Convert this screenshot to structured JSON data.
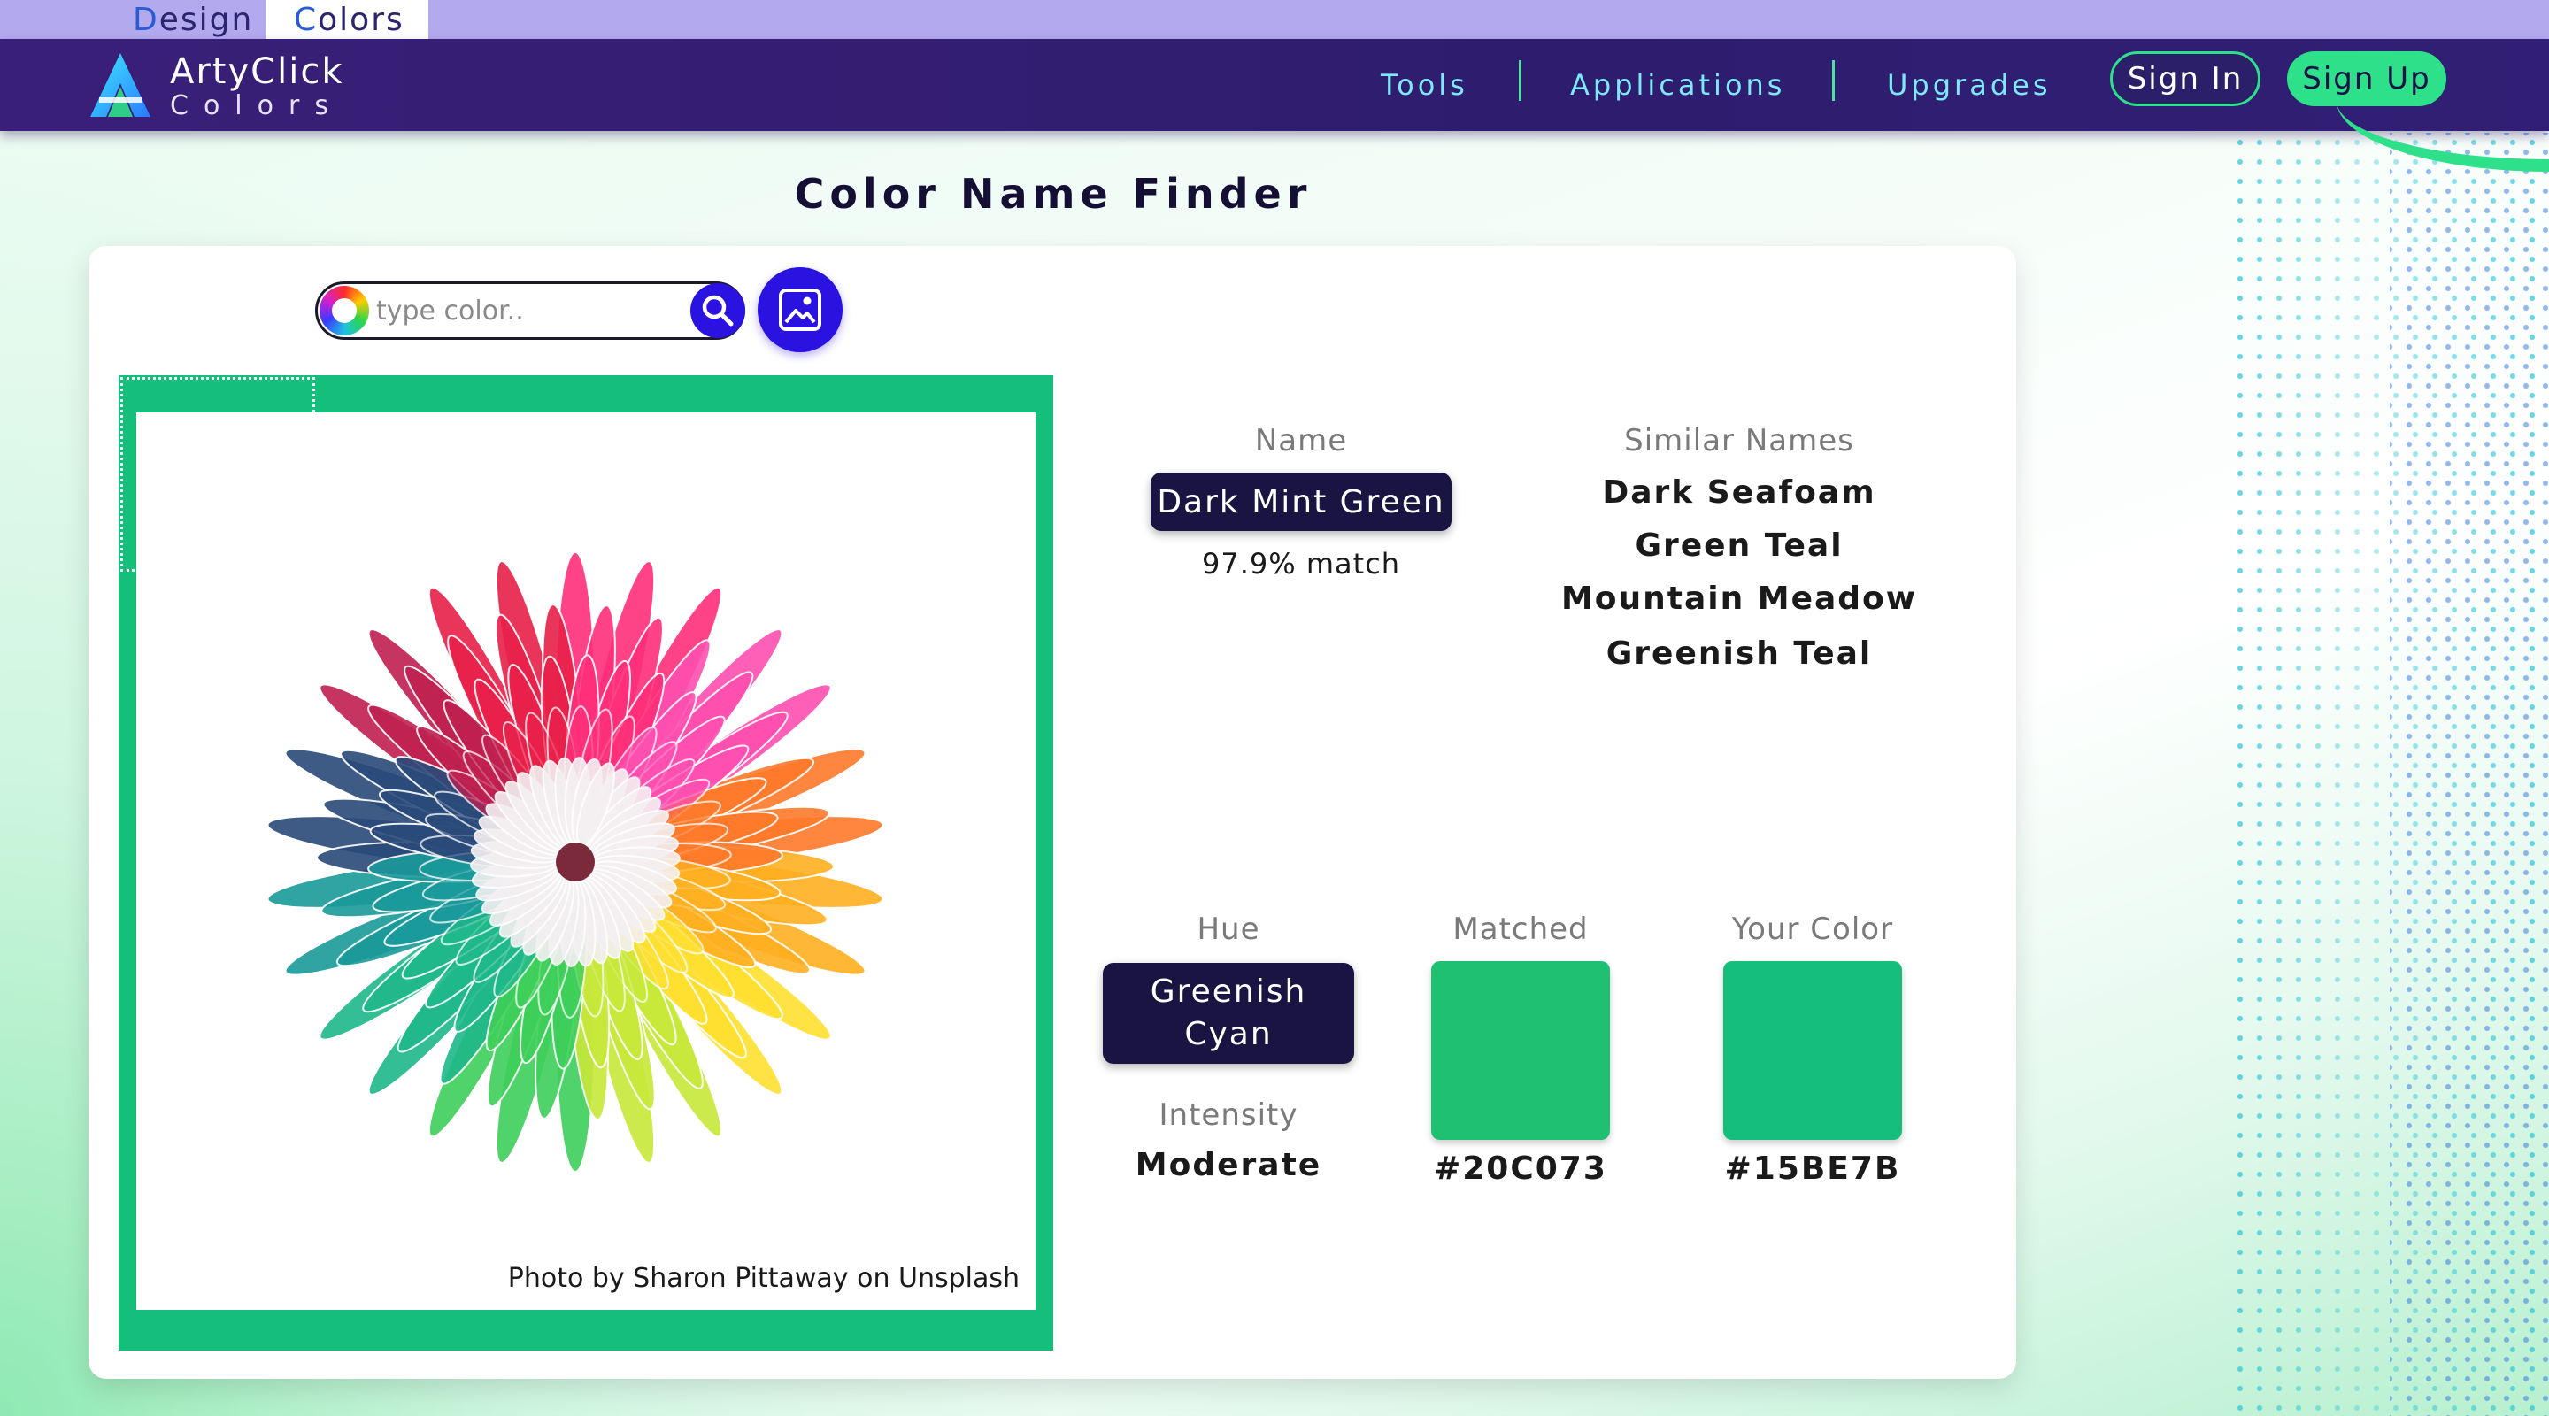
{
  "topbar": {
    "design_letter": "D",
    "design_rest": "esign",
    "colors_letter": "C",
    "colors_rest": "olors"
  },
  "header": {
    "brand_line1": "ArtyClick",
    "brand_line2": "Colors",
    "nav": [
      "Tools",
      "Applications",
      "Upgrades"
    ],
    "sign_in": "Sign In",
    "sign_up": "Sign Up",
    "accent": "#2de089",
    "bg": "#2e1d6e"
  },
  "page_title": "Color Name Finder",
  "search": {
    "placeholder": "type color..",
    "value": ""
  },
  "photo": {
    "credit": "Photo by Sharon Pittaway on Unsplash",
    "frame_color": "#16be7b"
  },
  "result": {
    "name_label": "Name",
    "name": "Dark Mint Green",
    "match": "97.9% match",
    "similar_label": "Similar Names",
    "similar": [
      "Dark Seafoam",
      "Green Teal",
      "Mountain Meadow",
      "Greenish Teal"
    ],
    "hue_label": "Hue",
    "hue": "Greenish Cyan",
    "intensity_label": "Intensity",
    "intensity": "Moderate",
    "matched_label": "Matched",
    "matched_hex": "#20C073",
    "your_label": "Your Color",
    "your_hex": "#15BE7B"
  },
  "icons": {
    "search": "magnifier-icon",
    "image": "image-upload-icon",
    "wheel": "color-wheel-icon",
    "logo": "artyclick-logo-icon"
  }
}
